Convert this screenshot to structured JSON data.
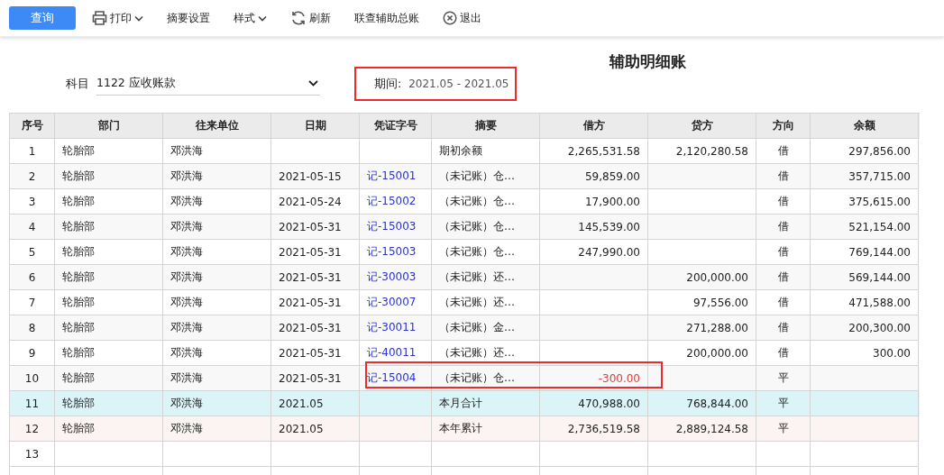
{
  "toolbar": {
    "query_button": "查询",
    "items": [
      {
        "kind": "print",
        "label": "打印",
        "dropdown": true
      },
      {
        "kind": "text",
        "label": "摘要设置",
        "dropdown": false
      },
      {
        "kind": "text",
        "label": "样式",
        "dropdown": true
      },
      {
        "kind": "refresh",
        "label": "刷新",
        "dropdown": false
      },
      {
        "kind": "text",
        "label": "联查辅助总账",
        "dropdown": false
      },
      {
        "kind": "exit",
        "label": "退出",
        "dropdown": false
      }
    ]
  },
  "title": "辅助明细账",
  "subject": {
    "label": "科目",
    "value": "1122 应收账款"
  },
  "period": {
    "label": "期间:",
    "value": "2021.05 - 2021.05",
    "highlighted": true
  },
  "table": {
    "columns": [
      "序号",
      "部门",
      "往来单位",
      "日期",
      "凭证字号",
      "摘要",
      "借方",
      "贷方",
      "方向",
      "余额"
    ],
    "rows": [
      {
        "kind": "normal",
        "no": "1",
        "dept": "轮胎部",
        "unit": "邓洪海",
        "date": "",
        "voucher": "",
        "summary": "期初余额",
        "debit": "2,265,531.58",
        "credit": "2,120,280.58",
        "dir": "借",
        "balance": "297,856.00",
        "negative": false,
        "highlighted": false
      },
      {
        "kind": "normal",
        "no": "2",
        "dept": "轮胎部",
        "unit": "邓洪海",
        "date": "2021-05-15",
        "voucher": "记-15001",
        "summary": "（未记账）仓…",
        "debit": "59,859.00",
        "credit": "",
        "dir": "借",
        "balance": "357,715.00",
        "negative": false,
        "highlighted": false
      },
      {
        "kind": "normal",
        "no": "3",
        "dept": "轮胎部",
        "unit": "邓洪海",
        "date": "2021-05-24",
        "voucher": "记-15002",
        "summary": "（未记账）仓…",
        "debit": "17,900.00",
        "credit": "",
        "dir": "借",
        "balance": "375,615.00",
        "negative": false,
        "highlighted": false
      },
      {
        "kind": "normal",
        "no": "4",
        "dept": "轮胎部",
        "unit": "邓洪海",
        "date": "2021-05-31",
        "voucher": "记-15003",
        "summary": "（未记账）仓…",
        "debit": "145,539.00",
        "credit": "",
        "dir": "借",
        "balance": "521,154.00",
        "negative": false,
        "highlighted": false
      },
      {
        "kind": "normal",
        "no": "5",
        "dept": "轮胎部",
        "unit": "邓洪海",
        "date": "2021-05-31",
        "voucher": "记-15003",
        "summary": "（未记账）仓…",
        "debit": "247,990.00",
        "credit": "",
        "dir": "借",
        "balance": "769,144.00",
        "negative": false,
        "highlighted": false
      },
      {
        "kind": "normal",
        "no": "6",
        "dept": "轮胎部",
        "unit": "邓洪海",
        "date": "2021-05-31",
        "voucher": "记-30003",
        "summary": "（未记账）还…",
        "debit": "",
        "credit": "200,000.00",
        "dir": "借",
        "balance": "569,144.00",
        "highlighted": false
      },
      {
        "kind": "normal",
        "no": "7",
        "dept": "轮胎部",
        "unit": "邓洪海",
        "date": "2021-05-31",
        "voucher": "记-30007",
        "summary": "（未记账）还…",
        "debit": "",
        "credit": "97,556.00",
        "dir": "借",
        "balance": "471,588.00",
        "highlighted": false
      },
      {
        "kind": "normal",
        "no": "8",
        "dept": "轮胎部",
        "unit": "邓洪海",
        "date": "2021-05-31",
        "voucher": "记-30011",
        "summary": "（未记账）金…",
        "debit": "",
        "credit": "271,288.00",
        "dir": "借",
        "balance": "200,300.00",
        "highlighted": false
      },
      {
        "kind": "normal",
        "no": "9",
        "dept": "轮胎部",
        "unit": "邓洪海",
        "date": "2021-05-31",
        "voucher": "记-40011",
        "summary": "（未记账）还…",
        "debit": "",
        "credit": "200,000.00",
        "dir": "借",
        "balance": "300.00",
        "highlighted": false
      },
      {
        "kind": "normal",
        "no": "10",
        "dept": "轮胎部",
        "unit": "邓洪海",
        "date": "2021-05-31",
        "voucher": "记-15004",
        "summary": "（未记账）仓…",
        "debit": "-300.00",
        "credit": "",
        "dir": "平",
        "balance": "",
        "negative": true,
        "highlighted": true
      },
      {
        "kind": "month_total",
        "no": "11",
        "dept": "轮胎部",
        "unit": "邓洪海",
        "date": "2021.05",
        "voucher": "",
        "summary": "本月合计",
        "debit": "470,988.00",
        "credit": "768,844.00",
        "dir": "平",
        "balance": "",
        "negative": false,
        "highlighted": false
      },
      {
        "kind": "year_total",
        "no": "12",
        "dept": "轮胎部",
        "unit": "邓洪海",
        "date": "2021.05",
        "voucher": "",
        "summary": "本年累计",
        "debit": "2,736,519.58",
        "credit": "2,889,124.58",
        "dir": "平",
        "balance": "",
        "negative": false,
        "highlighted": false
      },
      {
        "kind": "empty",
        "no": "13",
        "dept": "",
        "unit": "",
        "date": "",
        "voucher": "",
        "summary": "",
        "debit": "",
        "credit": "",
        "dir": "",
        "balance": "",
        "highlighted": false
      }
    ]
  }
}
